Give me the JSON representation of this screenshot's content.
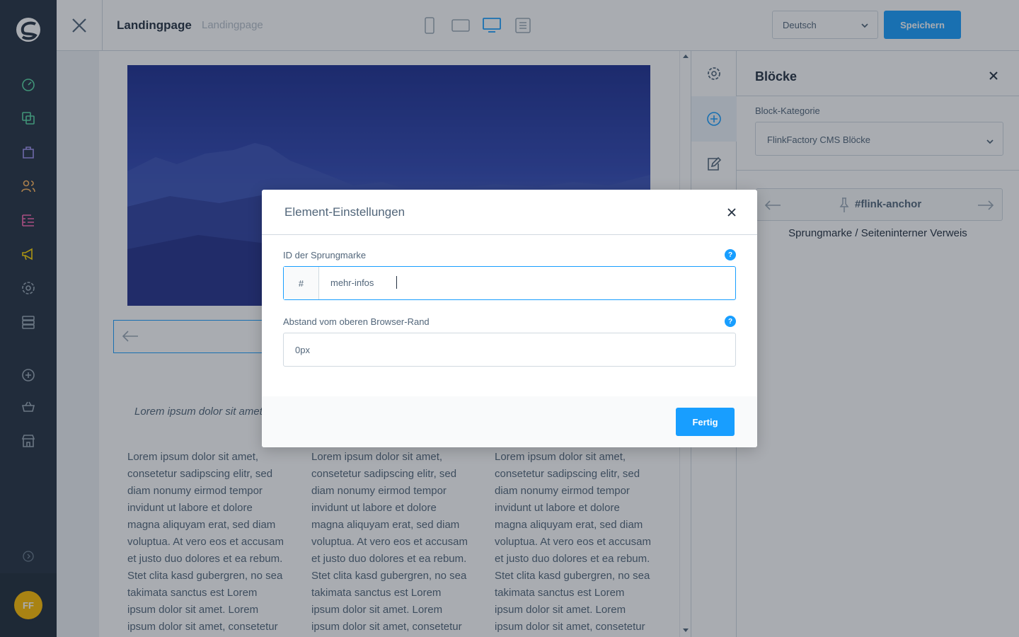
{
  "app": {
    "title": "Landingpage",
    "subtitle": "Landingpage"
  },
  "nav": {
    "icons": [
      "shopware-logo-icon",
      "dashboard-icon",
      "products-icon",
      "orders-icon",
      "customers-icon",
      "content-icon",
      "marketing-icon",
      "settings-icon",
      "storage-icon",
      "add-extension-icon",
      "basket-icon",
      "shop-icon",
      "help-icon"
    ],
    "avatar_initials": "FF",
    "colors": {
      "dashboard": "#57d9a3",
      "products": "#57d9a3",
      "orders": "#a092f0",
      "customers": "#ffd700",
      "content": "#ff68b4",
      "marketing": "#ffd700",
      "settings": "#9aa8b5"
    }
  },
  "topbar": {
    "views": [
      "mobile-view-icon",
      "tablet-view-icon",
      "desktop-view-icon",
      "form-view-icon"
    ],
    "active_view": "desktop-view-icon",
    "language": "Deutsch",
    "save_label": "Speichern"
  },
  "canvas": {
    "italic_text": "Lorem ipsum dolor sit amet",
    "columns": [
      "Lorem ipsum dolor sit amet, consetetur sadipscing elitr, sed diam nonumy eirmod tempor invidunt ut labore et dolore magna aliquyam erat, sed diam voluptua. At vero eos et accusam et justo duo dolores et ea rebum. Stet clita kasd gubergren, no sea takimata sanctus est Lorem ipsum dolor sit amet. Lorem ipsum dolor sit amet, consetetur",
      "Lorem ipsum dolor sit amet, consetetur sadipscing elitr, sed diam nonumy eirmod tempor invidunt ut labore et dolore magna aliquyam erat, sed diam voluptua. At vero eos et accusam et justo duo dolores et ea rebum. Stet clita kasd gubergren, no sea takimata sanctus est Lorem ipsum dolor sit amet. Lorem ipsum dolor sit amet, consetetur",
      "Lorem ipsum dolor sit amet, consetetur sadipscing elitr, sed diam nonumy eirmod tempor invidunt ut labore et dolore magna aliquyam erat, sed diam voluptua. At vero eos et accusam et justo duo dolores et ea rebum. Stet clita kasd gubergren, no sea takimata sanctus est Lorem ipsum dolor sit amet. Lorem ipsum dolor sit amet, consetetur"
    ]
  },
  "sidebar_tabs": {
    "icons": [
      "settings-icon",
      "add-block-icon",
      "edit-navigator-icon"
    ],
    "active": "add-block-icon"
  },
  "panel": {
    "title": "Blöcke",
    "category_label": "Block-Kategorie",
    "category_value": "FlinkFactory CMS Blöcke",
    "block_text": "#flink-anchor",
    "block_caption": "Sprungmarke / Seiteninterner Verweis"
  },
  "modal": {
    "title": "Element-Einstellungen",
    "id_label": "ID der Sprungmarke",
    "id_prefix": "#",
    "id_value": "mehr-infos",
    "top_label": "Abstand vom oberen Browser-Rand",
    "top_placeholder": "0px",
    "help_glyph": "?",
    "done_label": "Fertig"
  },
  "colors": {
    "primary": "#189eff",
    "nav_bg": "#243141",
    "avatar": "#ffbd00"
  }
}
